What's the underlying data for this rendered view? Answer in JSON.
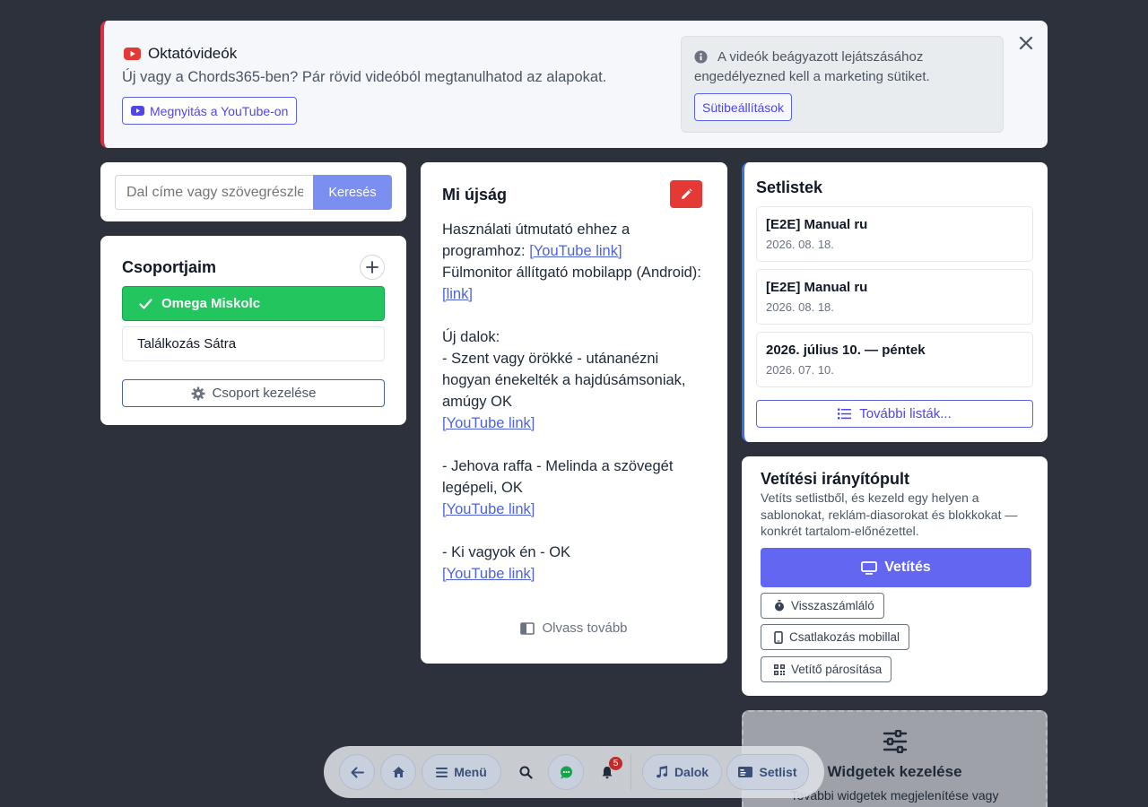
{
  "banner": {
    "title": "Oktatóvideók",
    "subtitle": "Új vagy a Chords365-ben? Pár rövid videóból megtanulhatod az alapokat.",
    "open_button": "Megnyitás a YouTube-on",
    "cookie_notice": "A videók beágyazott lejátszásához engedélyezned kell a marketing sütiket.",
    "cookie_button": "Sütibeállítások",
    "icons": {
      "video": "youtube-icon",
      "info": "info-icon",
      "close": "close-icon"
    },
    "colors": {
      "accent_border": "#dc2f45",
      "youtube": "#e53935"
    }
  },
  "search": {
    "placeholder": "Dal címe vagy szövegrészlete",
    "button": "Keresés"
  },
  "groups": {
    "title": "Csoportjaim",
    "items": [
      {
        "label": "Omega Miskolc",
        "active": true
      },
      {
        "label": "Találkozás Sátra",
        "active": false
      }
    ],
    "manage_button": "Csoport kezelése",
    "colors": {
      "active": "#22c55e"
    }
  },
  "news": {
    "title": "Mi újság",
    "lines": [
      {
        "text": "Használati útmutató ehhez a programhoz: ",
        "link": "[YouTube link]"
      },
      {
        "text": "Fülmonitor állítgató mobilapp (Android): ",
        "link": "[link]"
      },
      {
        "text": "",
        "link": ""
      },
      {
        "text": "Új dalok:",
        "link": ""
      },
      {
        "text": "- Szent vagy örökké - utánanézni hogyan énekelték a hajdúsámsoniak, amúgy OK",
        "link": ""
      },
      {
        "text": "",
        "link": "[YouTube link]"
      },
      {
        "text": "",
        "link": ""
      },
      {
        "text": "- Jehova raffa - Melinda a szövegét legépeli, OK",
        "link": ""
      },
      {
        "text": "",
        "link": "[YouTube link]"
      },
      {
        "text": "",
        "link": ""
      },
      {
        "text": "- Ki vagyok én - OK",
        "link": ""
      },
      {
        "text": "",
        "link": "[YouTube link]"
      }
    ],
    "read_more": "Olvass tovább"
  },
  "setlists": {
    "title": "Setlistek",
    "items": [
      {
        "name": "[E2E] Manual ru",
        "date": "2026. 08. 18."
      },
      {
        "name": "[E2E] Manual ru",
        "date": "2026. 08. 18."
      },
      {
        "name": "2026. július 10. — péntek",
        "date": "2026. 07. 10."
      }
    ],
    "more_button": "További listák..."
  },
  "projection": {
    "title": "Vetítési irányítópult",
    "description": "Vetíts setlistből, és kezeld egy helyen a sablonokat, reklám-diasorokat és blokkokat — konkrét tartalom-előnézettel.",
    "main_button": "Vetítés",
    "countdown_button": "Visszaszámláló",
    "mobile_button": "Csatlakozás mobillal",
    "pairing_button": "Vetítő párosítása",
    "colors": {
      "main": "#6366f1"
    }
  },
  "widgets": {
    "title": "Widgetek kezelése",
    "description": "További widgetek megjelenítése vagy"
  },
  "nav": {
    "menu": "Menü",
    "songs": "Dalok",
    "setlist": "Setlist",
    "notification_count": "5"
  }
}
